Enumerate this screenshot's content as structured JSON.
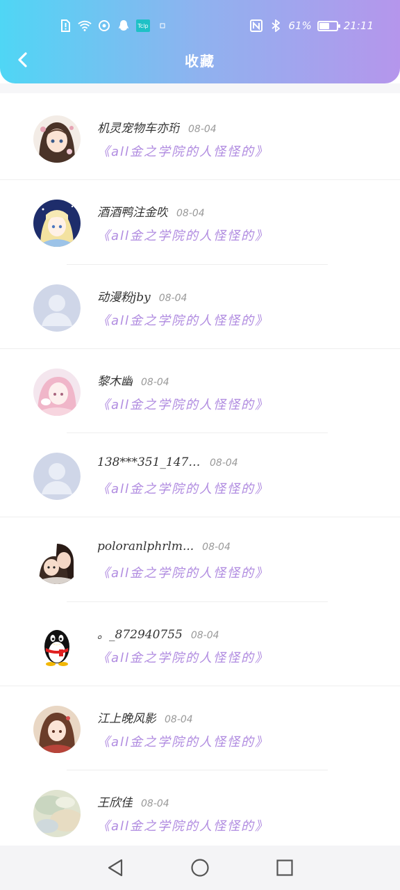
{
  "status_bar": {
    "battery_text": "61%",
    "time": "21:11",
    "battery_level": 0.61,
    "app_tag": "Tclp"
  },
  "header": {
    "title": "收藏",
    "back_icon": "chevron-left-icon"
  },
  "items": [
    {
      "name": "机灵宠物车亦珩",
      "date": "08-04",
      "book": "《all金之学院的人怪怪的》",
      "avatar": "anime-girl-flowers"
    },
    {
      "name": "酒酒鸭注金吹",
      "date": "08-04",
      "book": "《all金之学院的人怪怪的》",
      "avatar": "anime-blonde-blue"
    },
    {
      "name": "动漫粉jby",
      "date": "08-04",
      "book": "《all金之学院的人怪怪的》",
      "avatar": "default-avatar"
    },
    {
      "name": "黎木幽",
      "date": "08-04",
      "book": "《all金之学院的人怪怪的》",
      "avatar": "anime-pink-hair"
    },
    {
      "name": "138***351_1475...",
      "date": "08-04",
      "book": "《all金之学院的人怪怪的》",
      "avatar": "default-avatar"
    },
    {
      "name": "poloranlphrlm...",
      "date": "08-04",
      "book": "《all金之学院的人怪怪的》",
      "avatar": "anime-couple"
    },
    {
      "name": "。_872940755",
      "date": "08-04",
      "book": "《all金之学院的人怪怪的》",
      "avatar": "qq-penguin"
    },
    {
      "name": "江上晚风影",
      "date": "08-04",
      "book": "《all金之学院的人怪怪的》",
      "avatar": "anime-brown-hair"
    },
    {
      "name": "王欣佳",
      "date": "08-04",
      "book": "《all金之学院的人怪怪的》",
      "avatar": "watercolor"
    }
  ],
  "bottom_nav": {
    "back": "triangle-back-icon",
    "home": "circle-home-icon",
    "recent": "square-recent-icon"
  }
}
